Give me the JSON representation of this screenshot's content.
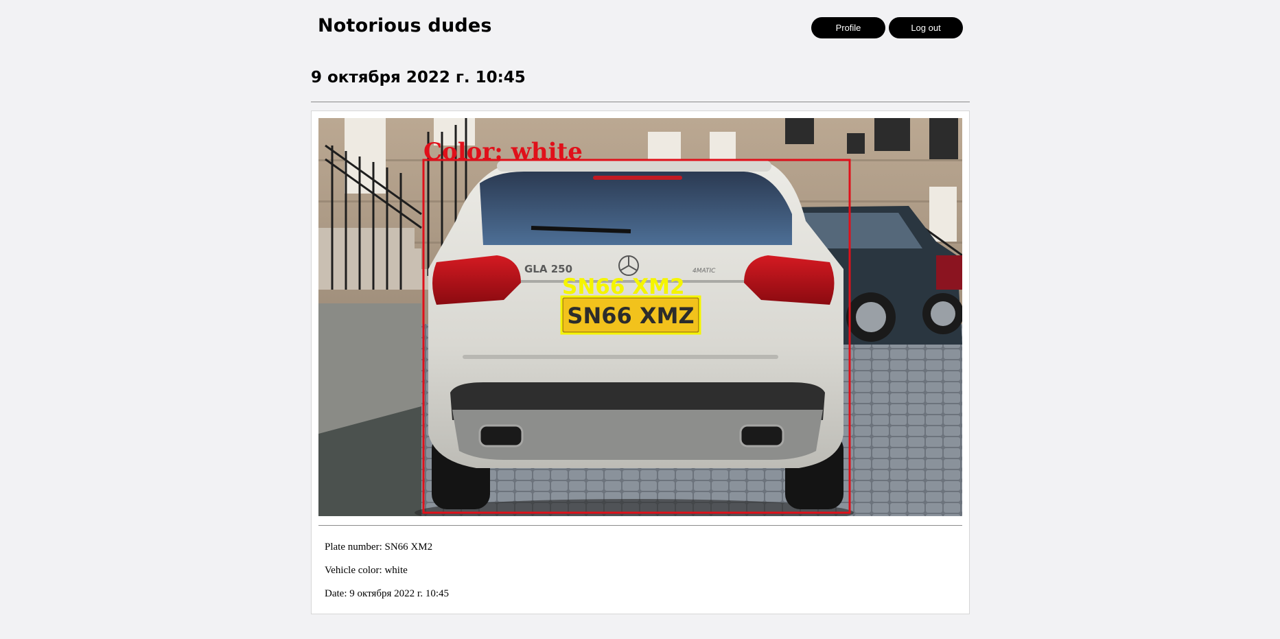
{
  "header": {
    "title": "Notorious dudes",
    "profile_label": "Profile",
    "logout_label": "Log out"
  },
  "record": {
    "heading": "9 октября 2022 г. 10:45",
    "photo": {
      "color_annotation": "Color: white",
      "plate_annotation": "SN66 XM2",
      "plate_text": "SN66 XMZ",
      "model_badge": "GLA 250",
      "trim_badge": "4MATIC",
      "box_color": "#e0101a",
      "plate_box_color": "#f5f500"
    },
    "details": {
      "plate_line": "Plate number: SN66 XM2",
      "color_line": "Vehicle color: white",
      "date_line": "Date: 9 октября 2022 г. 10:45"
    }
  }
}
